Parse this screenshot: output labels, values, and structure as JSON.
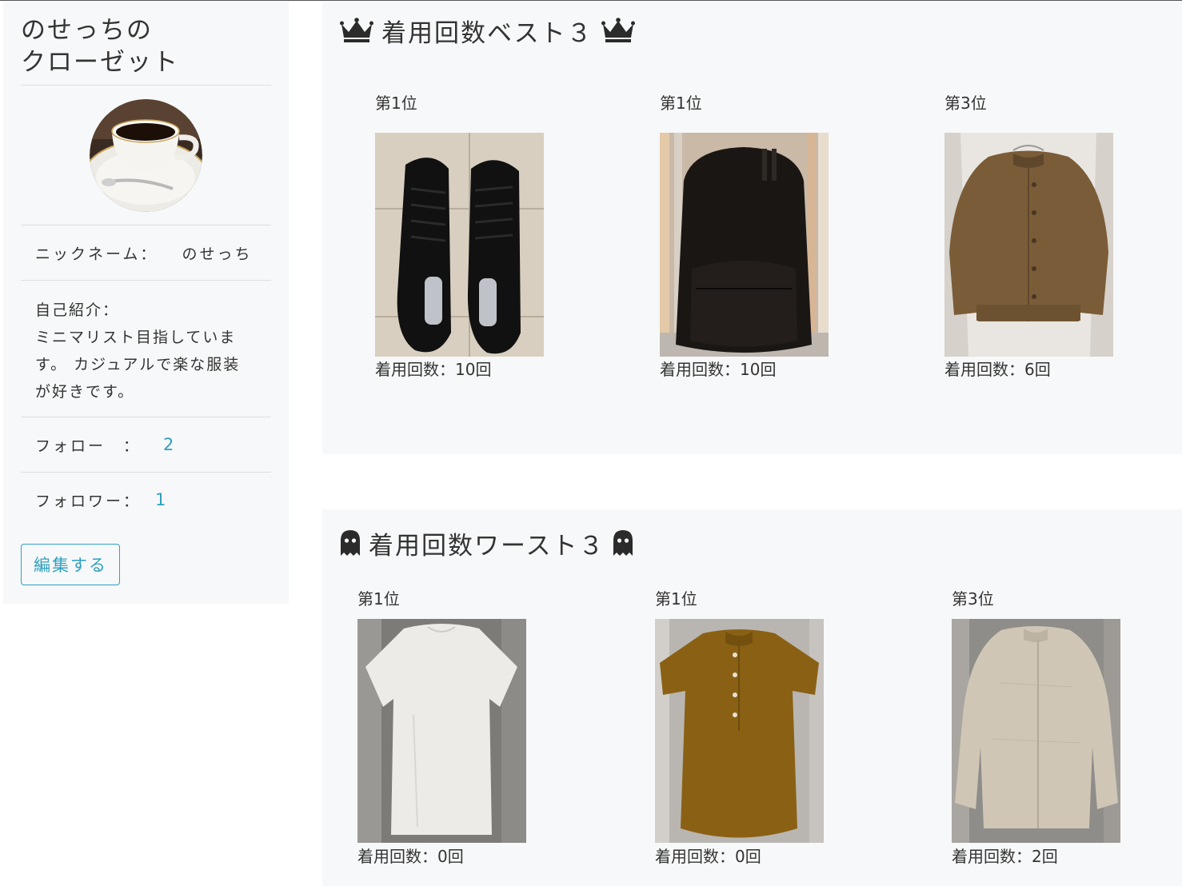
{
  "sidebar": {
    "site_title": "のせっちの\nクローゼット",
    "nickname_label": "ニックネーム：",
    "nickname_value": "のせっち",
    "intro_label": "自己紹介：",
    "intro_text": "ミニマリスト目指していま す。 カジュアルで楽な服装が好きです。",
    "follow_label": "フォロー　：",
    "follow_count": "2",
    "follower_label": "フォロワー：",
    "follower_count": "1",
    "edit_button": "編集する"
  },
  "best": {
    "title": "着用回数ベスト３",
    "icon": "crown-icon",
    "items": [
      {
        "rank": "第1位",
        "count_label": "着用回数：10回",
        "image": "black-sneakers"
      },
      {
        "rank": "第1位",
        "count_label": "着用回数：10回",
        "image": "black-backpack"
      },
      {
        "rank": "第3位",
        "count_label": "着用回数：6回",
        "image": "brown-jacket"
      }
    ]
  },
  "worst": {
    "title": "着用回数ワースト３",
    "icon": "ghost-icon",
    "items": [
      {
        "rank": "第1位",
        "count_label": "着用回数：0回",
        "image": "white-tshirt"
      },
      {
        "rank": "第1位",
        "count_label": "着用回数：0回",
        "image": "mustard-blouse"
      },
      {
        "rank": "第3位",
        "count_label": "着用回数：2回",
        "image": "beige-linen-shirt"
      }
    ]
  },
  "colors": {
    "accent": "#2fa0bf",
    "panel_bg": "#f7f8f9",
    "text": "#333333"
  }
}
